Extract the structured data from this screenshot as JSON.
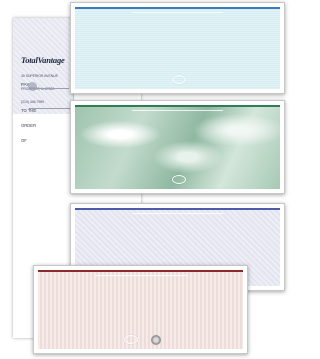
{
  "sheet": {
    "brand": "TotalVantage",
    "address_lines": [
      "40 SUPERIOR AVENUE",
      "PROSPECT, IL 67890",
      "(210) 446-7990"
    ],
    "pay_label": "PAY",
    "order_label_lines": [
      "TO THE",
      "ORDER",
      "OF"
    ]
  },
  "checks": [
    {
      "name": "blue",
      "color": "#3b7bbd"
    },
    {
      "name": "green-marble",
      "color": "#2f7d54"
    },
    {
      "name": "lavender",
      "color": "#4f5aa8"
    },
    {
      "name": "burgundy",
      "color": "#8a2a2a"
    }
  ],
  "icons": [
    "padlock-icon",
    "security-badge-icon"
  ]
}
